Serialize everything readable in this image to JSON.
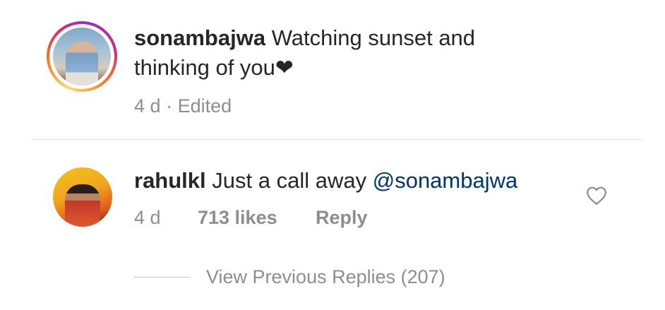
{
  "caption": {
    "username": "sonambajwa",
    "text_line1": "Watching sunset and",
    "text_line2": "thinking of you",
    "heart_glyph": "❤",
    "time": "4 d",
    "separator": "·",
    "edited": "Edited"
  },
  "comment": {
    "username": "rahulkl",
    "text": "Just a call away",
    "mention": "@sonambajwa",
    "time": "4 d",
    "likes": "713 likes",
    "reply_label": "Reply",
    "like_icon": "heart-outline-icon"
  },
  "replies": {
    "view_previous_label": "View Previous Replies (207)"
  },
  "colors": {
    "text": "#262626",
    "meta": "#8e8e8e",
    "mention": "#003569",
    "divider": "#dbdbdb"
  }
}
